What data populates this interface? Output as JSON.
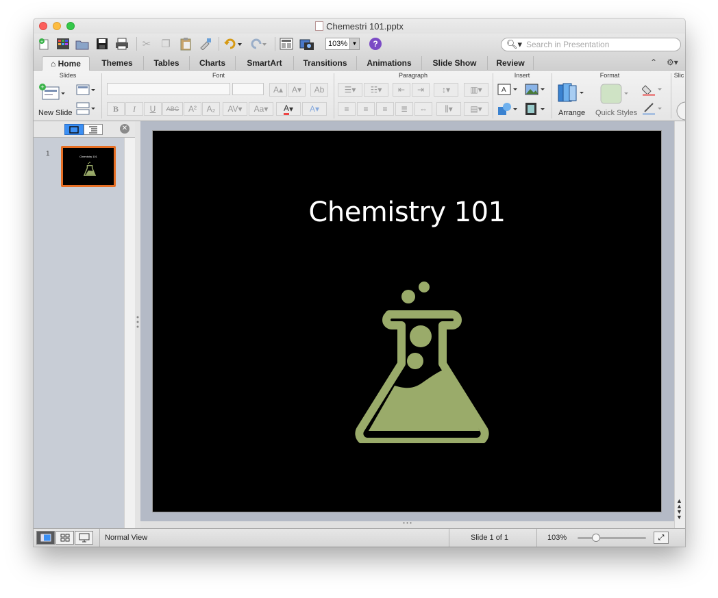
{
  "window": {
    "title": "Chemestri 101.pptx"
  },
  "toolbar": {
    "zoom_value": "103%",
    "search_placeholder": "Search in Presentation"
  },
  "tabs": [
    {
      "label": "Home"
    },
    {
      "label": "Themes"
    },
    {
      "label": "Tables"
    },
    {
      "label": "Charts"
    },
    {
      "label": "SmartArt"
    },
    {
      "label": "Transitions"
    },
    {
      "label": "Animations"
    },
    {
      "label": "Slide Show"
    },
    {
      "label": "Review"
    }
  ],
  "ribbon": {
    "groups": {
      "slides": "Slides",
      "font": "Font",
      "paragraph": "Paragraph",
      "insert": "Insert",
      "format": "Format",
      "slide_show": "Slic"
    },
    "new_slide_label": "New Slide",
    "arrange_label": "Arrange",
    "quick_styles_label": "Quick Styles"
  },
  "slide_panel": {
    "thumbs": [
      {
        "number": "1",
        "title": "Chemistry 101"
      }
    ]
  },
  "slide": {
    "title": "Chemistry 101",
    "icon": "chemistry-flask-icon",
    "icon_color": "#9aab6a",
    "background": "#000000"
  },
  "status": {
    "view_name": "Normal View",
    "slide_position": "Slide 1 of 1",
    "zoom": "103%"
  },
  "colors": {
    "thumb_border": "#e66f25",
    "active_view": "#3b8ff4"
  }
}
